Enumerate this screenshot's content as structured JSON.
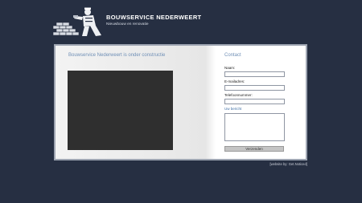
{
  "header": {
    "title": "BOUWSERVICE NEDERWEERT",
    "subtitle": "Nieuwbouw en renovatie",
    "logo_icon": "bricklayer-logo-icon"
  },
  "main": {
    "heading": "Bouwservice Nederweert is onder constructie"
  },
  "contact": {
    "title": "Contact",
    "name_label": "Naam:",
    "email_label": "E-mailadres:",
    "phone_label": "Telefoonnummer:",
    "message_label": "Uw bericht",
    "submit_label": "Verzenden"
  },
  "footer": {
    "credit": "[website by:  Get.Noticed]"
  },
  "colors": {
    "background": "#262f42",
    "accent": "#6f8fb6",
    "video": "#2f2f2f"
  }
}
